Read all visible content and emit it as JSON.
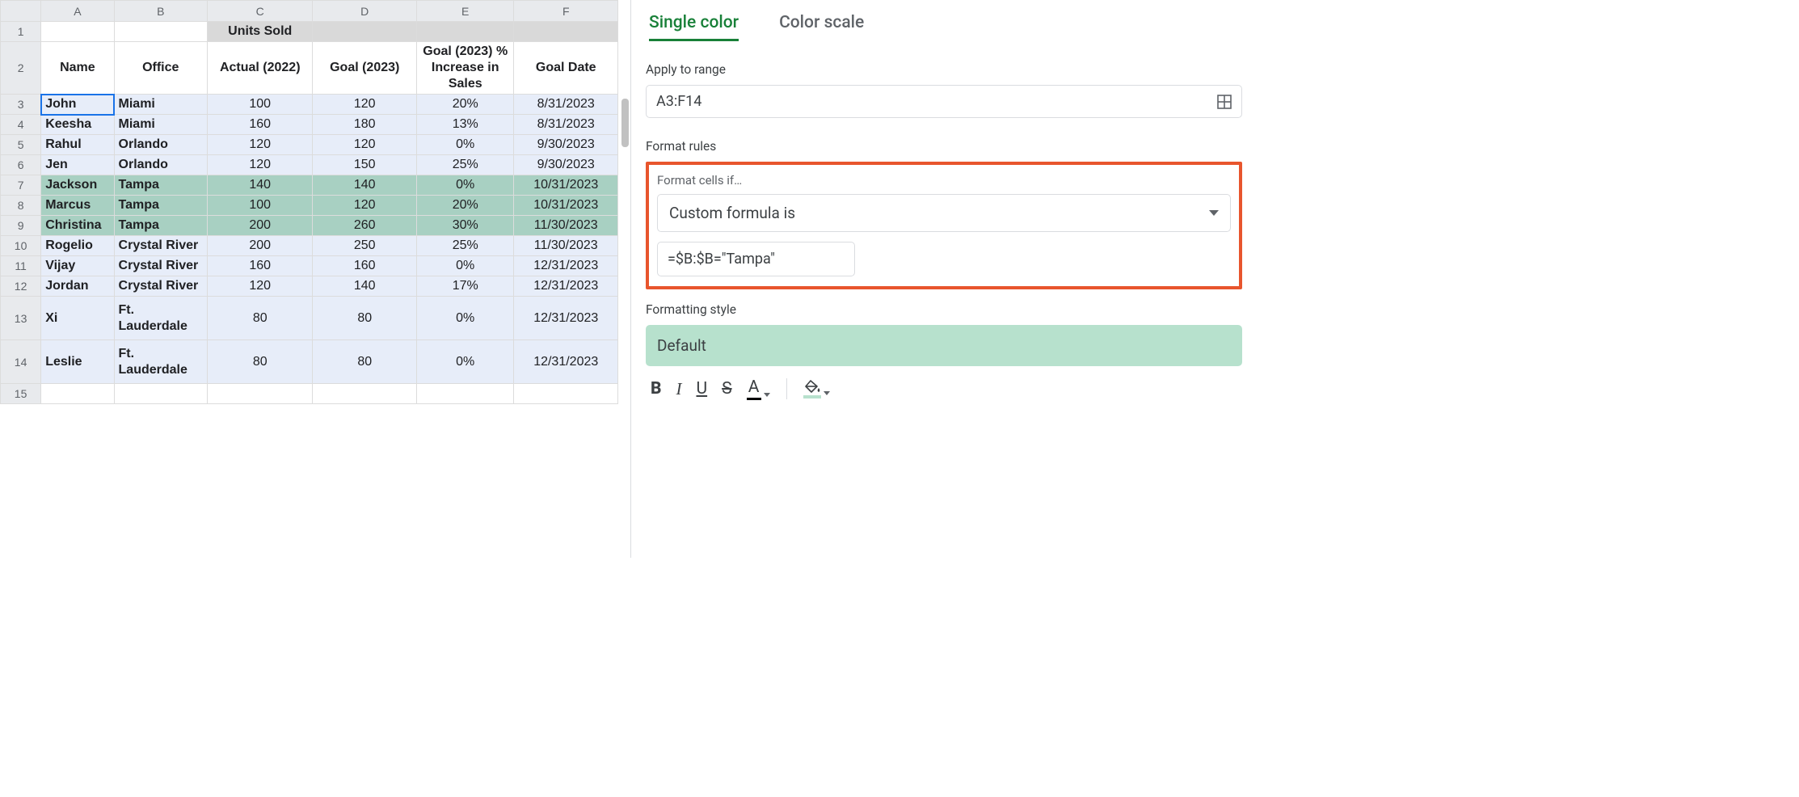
{
  "columns": [
    "A",
    "B",
    "C",
    "D",
    "E",
    "F"
  ],
  "row_headers": [
    "1",
    "2",
    "3",
    "4",
    "5",
    "6",
    "7",
    "8",
    "9",
    "10",
    "11",
    "12",
    "13",
    "14",
    "15"
  ],
  "headers": {
    "units_sold": "Units Sold",
    "name": "Name",
    "office": "Office",
    "actual": "Actual (2022)",
    "goal": "Goal (2023)",
    "pct": "Goal (2023) % Increase in Sales",
    "date": "Goal Date"
  },
  "rows": [
    {
      "name": "John",
      "office": "Miami",
      "actual": "100",
      "goal": "120",
      "pct": "20%",
      "date": "8/31/2023",
      "tampa": false
    },
    {
      "name": "Keesha",
      "office": "Miami",
      "actual": "160",
      "goal": "180",
      "pct": "13%",
      "date": "8/31/2023",
      "tampa": false
    },
    {
      "name": "Rahul",
      "office": "Orlando",
      "actual": "120",
      "goal": "120",
      "pct": "0%",
      "date": "9/30/2023",
      "tampa": false
    },
    {
      "name": "Jen",
      "office": "Orlando",
      "actual": "120",
      "goal": "150",
      "pct": "25%",
      "date": "9/30/2023",
      "tampa": false
    },
    {
      "name": "Jackson",
      "office": "Tampa",
      "actual": "140",
      "goal": "140",
      "pct": "0%",
      "date": "10/31/2023",
      "tampa": true
    },
    {
      "name": "Marcus",
      "office": "Tampa",
      "actual": "100",
      "goal": "120",
      "pct": "20%",
      "date": "10/31/2023",
      "tampa": true
    },
    {
      "name": "Christina",
      "office": "Tampa",
      "actual": "200",
      "goal": "260",
      "pct": "30%",
      "date": "11/30/2023",
      "tampa": true
    },
    {
      "name": "Rogelio",
      "office": "Crystal River",
      "actual": "200",
      "goal": "250",
      "pct": "25%",
      "date": "11/30/2023",
      "tampa": false
    },
    {
      "name": "Vijay",
      "office": "Crystal River",
      "actual": "160",
      "goal": "160",
      "pct": "0%",
      "date": "12/31/2023",
      "tampa": false
    },
    {
      "name": "Jordan",
      "office": "Crystal River",
      "actual": "120",
      "goal": "140",
      "pct": "17%",
      "date": "12/31/2023",
      "tampa": false
    },
    {
      "name": "Xi",
      "office": "Ft. Lauderdale",
      "actual": "80",
      "goal": "80",
      "pct": "0%",
      "date": "12/31/2023",
      "tampa": false,
      "tall": true
    },
    {
      "name": "Leslie",
      "office": "Ft. Lauderdale",
      "actual": "80",
      "goal": "80",
      "pct": "0%",
      "date": "12/31/2023",
      "tampa": false,
      "tall": true
    }
  ],
  "sidebar": {
    "tab_single": "Single color",
    "tab_scale": "Color scale",
    "apply_label": "Apply to range",
    "range_value": "A3:F14",
    "rules_label": "Format rules",
    "cells_if_label": "Format cells if…",
    "condition": "Custom formula is",
    "formula": "=$B:$B=\"Tampa\"",
    "style_label": "Formatting style",
    "style_name": "Default",
    "toolbar": {
      "bold": "B",
      "italic": "I",
      "underline": "U",
      "strike": "S",
      "textcolor": "A"
    }
  }
}
